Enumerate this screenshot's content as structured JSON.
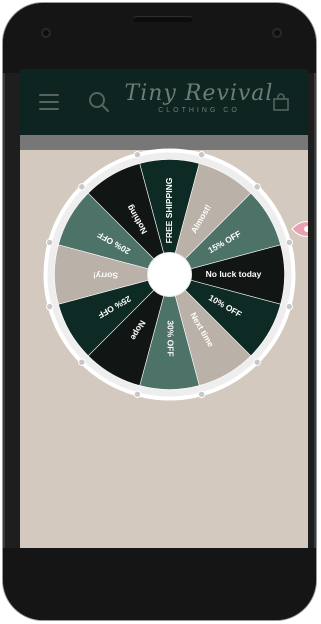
{
  "header": {
    "logo_script": "Tiny Revival",
    "logo_sub": "CLOTHING CO"
  },
  "wheel": {
    "segments": [
      {
        "label": "No luck today",
        "color": "#111614"
      },
      {
        "label": "10% OFF",
        "color": "#0e2a24"
      },
      {
        "label": "Next time",
        "color": "#bab1a8"
      },
      {
        "label": "30% OFF",
        "color": "#4d7267"
      },
      {
        "label": "Nope",
        "color": "#111614"
      },
      {
        "label": "25% OFF",
        "color": "#0e2a24"
      },
      {
        "label": "Sorry!",
        "color": "#bab1a8"
      },
      {
        "label": "20% OFF",
        "color": "#4d7267"
      },
      {
        "label": "Nothing",
        "color": "#111614"
      },
      {
        "label": "FREE SHIPPING",
        "color": "#0e2a24"
      },
      {
        "label": "Almost!",
        "color": "#bab1a8"
      },
      {
        "label": "15% OFF",
        "color": "#4d7267"
      }
    ]
  },
  "colors": {
    "header_bg": "#0e2421",
    "screen_bg": "#d3c9bf",
    "pointer": "#e9a0b2"
  }
}
